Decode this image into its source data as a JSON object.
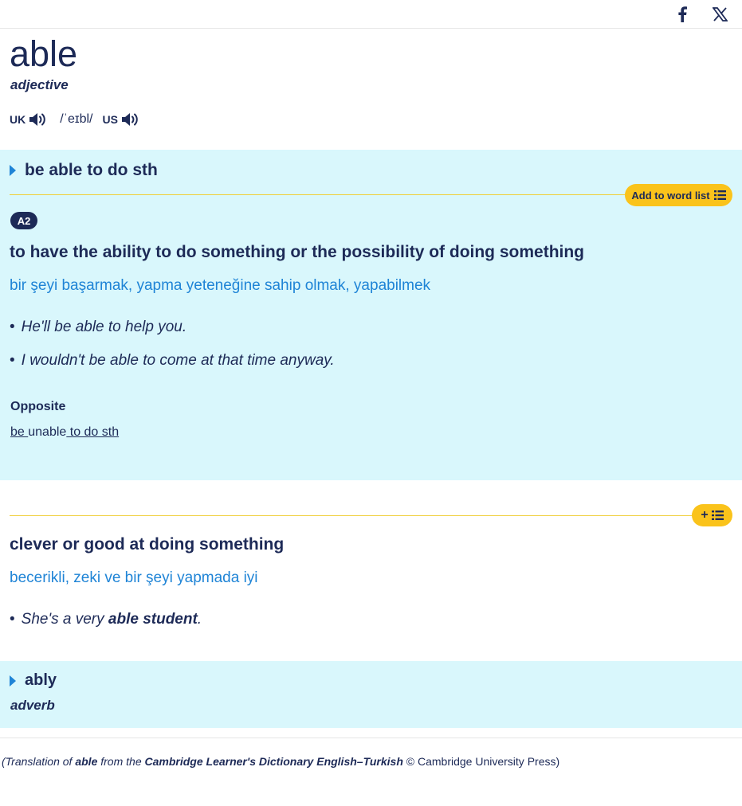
{
  "share": {
    "facebook_icon": "facebook-icon",
    "x_icon": "x-icon"
  },
  "entry": {
    "headword": "able",
    "pos": "adjective",
    "pron": {
      "uk_label": "UK",
      "us_label": "US",
      "ipa": "/ˈeɪbl/"
    }
  },
  "sense1": {
    "phrase": "be able to do sth",
    "add_to_word_list": "Add to word list",
    "level": "A2",
    "definition": "to have the ability to do something or the possibility of doing something",
    "translation": "bir şeyi başarmak, yapma yeteneğine sahip olmak, yapabilmek",
    "examples": [
      "He'll be able to help you.",
      "I wouldn't be able to come at that time anyway."
    ],
    "opposite_label": "Opposite",
    "opposite": {
      "part1": "be ",
      "part2": "unable",
      "part3": " to do sth"
    }
  },
  "sense2": {
    "add_button": "+",
    "definition": "clever or good at doing something",
    "translation": "becerikli, zeki ve bir şeyi yapmada iyi",
    "example": {
      "pre": "She's a very ",
      "bold": "able student",
      "post": "."
    }
  },
  "derived": {
    "word": "ably",
    "pos": "adverb"
  },
  "credit": {
    "t1": "(Translation of ",
    "word": "able",
    "t2": " from the ",
    "dict": "Cambridge Learner's Dictionary English–Turkish",
    "t3": " © Cambridge University Press)"
  },
  "colors": {
    "panel_bg": "#d9f7fc",
    "navy": "#1d2a57",
    "blue": "#1f84d6",
    "yellow": "#fac31b"
  }
}
